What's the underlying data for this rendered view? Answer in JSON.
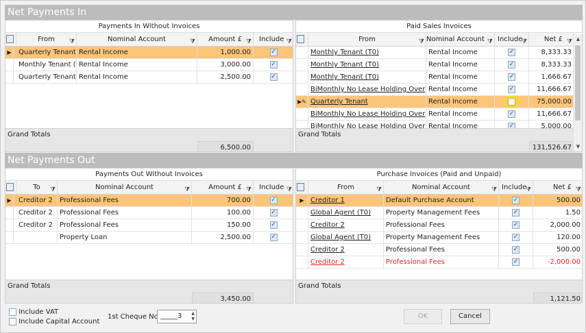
{
  "net_in": {
    "title": "Net Payments In",
    "no_inv": {
      "title": "Payments In Without Invoices",
      "cols": [
        "From",
        "Nominal Account",
        "Amount £",
        "Include"
      ],
      "rows": [
        {
          "from": "Quarterly Tenant",
          "nominal": "Rental Income",
          "amount": "1,000.00",
          "include": true,
          "selected": true
        },
        {
          "from": "Monthly Tenant (T",
          "nominal": "Rental Income",
          "amount": "3,000.00",
          "include": true
        },
        {
          "from": "Quarterly Tenant",
          "nominal": "Rental Income",
          "amount": "2,500.00",
          "include": true
        }
      ],
      "grand_label": "Grand Totals",
      "grand_value": "6,500.00"
    },
    "sales": {
      "title": "Paid Sales Invoices",
      "cols": [
        "From",
        "Nominal Account",
        "Include",
        "Net £"
      ],
      "rows": [
        {
          "from": "Monthly Tenant (T0)",
          "nominal": "Rental Income",
          "include": true,
          "net": "8,333.33"
        },
        {
          "from": "Monthly Tenant (T0)",
          "nominal": "Rental Income",
          "include": true,
          "net": "8,333.33"
        },
        {
          "from": "Monthly Tenant (T0)",
          "nominal": "Rental Income",
          "include": true,
          "net": "1,666.67"
        },
        {
          "from": "BiMonthly No Lease Holding Over",
          "nominal": "Rental Income",
          "include": true,
          "net": "11,666.67"
        },
        {
          "from": "Quarterly Tenant",
          "nominal": "Rental Income",
          "include": false,
          "net": "75,000.00",
          "selected": true
        },
        {
          "from": "BiMonthly No Lease Holding Over",
          "nominal": "Rental Income",
          "include": true,
          "net": "11,666.67"
        },
        {
          "from": "BiMonthly No Lease Holding Over",
          "nominal": "Rental Income",
          "include": true,
          "net": "5,000.00"
        }
      ],
      "grand_label": "Grand Totals",
      "grand_value": "131,526.67"
    }
  },
  "net_out": {
    "title": "Net Payments Out",
    "no_inv": {
      "title": "Payments Out Without Invoices",
      "cols": [
        "To",
        "Nominal Account",
        "Amount £",
        "Include"
      ],
      "rows": [
        {
          "to": "Creditor 2",
          "nominal": "Professional Fees",
          "amount": "700.00",
          "include": true,
          "selected": true
        },
        {
          "to": "Creditor 2",
          "nominal": "Professional Fees",
          "amount": "100.00",
          "include": true
        },
        {
          "to": "Creditor 2",
          "nominal": "Professional Fees",
          "amount": "150.00",
          "include": true
        },
        {
          "to": "",
          "nominal": "Property Loan",
          "amount": "2,500.00",
          "include": true
        }
      ],
      "grand_label": "Grand Totals",
      "grand_value": "3,450.00"
    },
    "purchase": {
      "title": "Purchase Invoices (Paid and Unpaid)",
      "cols": [
        "From",
        "Nominal Account",
        "Include",
        "Net £"
      ],
      "rows": [
        {
          "from": "Creditor 1",
          "nominal": "Default Purchase Account",
          "include": true,
          "net": "500.00",
          "selected": true
        },
        {
          "from": "Global Agent (T0)",
          "nominal": "Property Management Fees",
          "include": true,
          "net": "1.50"
        },
        {
          "from": "Creditor 2",
          "nominal": "Professional Fees",
          "include": true,
          "net": "2,000.00"
        },
        {
          "from": "Global Agent (T0)",
          "nominal": "Property Management Fees",
          "include": true,
          "net": "120.00"
        },
        {
          "from": "Creditor 2",
          "nominal": "Professional Fees",
          "include": true,
          "net": "500.00"
        },
        {
          "from": "Creditor 2",
          "nominal": "Professional Fees",
          "include": true,
          "net": "-2,000.00",
          "negative": true
        }
      ],
      "grand_label": "Grand Totals",
      "grand_value": "1,121.50"
    }
  },
  "footer": {
    "include_vat": "Include VAT",
    "include_capital": "Include Capital Account",
    "cheque_label": "1st Cheque No.",
    "cheque_value": "_____3",
    "ok": "OK",
    "cancel": "Cancel"
  },
  "glyphs": {
    "filter": "⧩",
    "check": "✓",
    "current_row": "▶",
    "edit_row": "▶✎",
    "up": "▲",
    "down": "▼"
  }
}
